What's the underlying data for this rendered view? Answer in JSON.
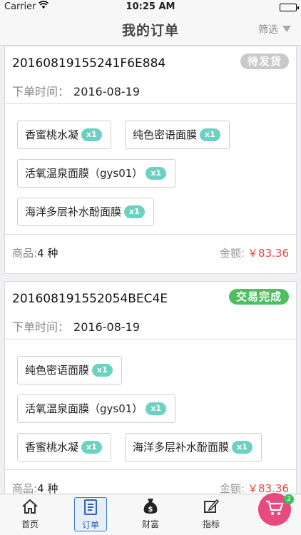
{
  "status_bar": {
    "carrier": "Carrier",
    "time": "10:25 AM"
  },
  "nav": {
    "title": "我的订单",
    "filter_label": "筛选"
  },
  "labels": {
    "order_time": "下单时间：",
    "goods": "商品:",
    "amount": "金额:"
  },
  "colors": {
    "pending": "#c9c9c9",
    "completed": "#4cc05e",
    "price": "#e4473c",
    "qty_badge": "#6dd1c2",
    "accent": "#3a78c3",
    "cart": "#e84a7f"
  },
  "orders": [
    {
      "order_no": "20160819155241F6E884",
      "status": "待发货",
      "status_color": "#c9c9c9",
      "date": "2016-08-19",
      "items": [
        {
          "name": "香蜜桃水凝",
          "qty": "x1"
        },
        {
          "name": "纯色密语面膜",
          "qty": "x1"
        },
        {
          "name": "活氧温泉面膜（gys01）",
          "qty": "x1"
        },
        {
          "name": "海洋多层补水酚面膜",
          "qty": "x1"
        }
      ],
      "count": "4 种",
      "amount": "￥83.36"
    },
    {
      "order_no": "201608191552054BEC4E",
      "status": "交易完成",
      "status_color": "#4cc05e",
      "date": "2016-08-19",
      "items": [
        {
          "name": "纯色密语面膜",
          "qty": "x1"
        },
        {
          "name": "活氧温泉面膜（gys01）",
          "qty": "x1"
        },
        {
          "name": "香蜜桃水凝",
          "qty": "x1"
        },
        {
          "name": "海洋多层补水酚面膜",
          "qty": "x1"
        }
      ],
      "count": "4 种",
      "amount": "￥83.36"
    }
  ],
  "tabs": [
    {
      "label": "首页",
      "icon": "home-icon"
    },
    {
      "label": "订单",
      "icon": "order-list-icon",
      "active": true
    },
    {
      "label": "财富",
      "icon": "money-bag-icon"
    },
    {
      "label": "指标",
      "icon": "edit-icon"
    }
  ],
  "cart": {
    "badge": "2",
    "icon": "cart-icon"
  }
}
